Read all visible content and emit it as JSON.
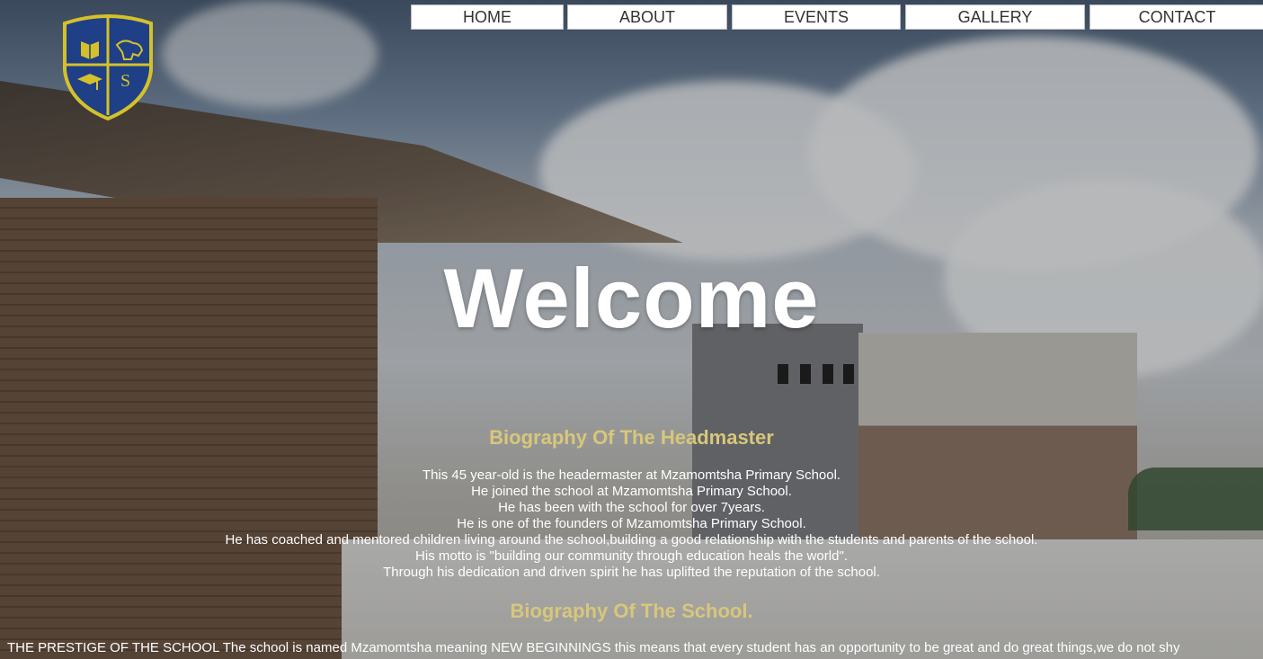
{
  "nav": {
    "items": [
      "HOME",
      "ABOUT",
      "EVENTS",
      "GALLERY",
      "CONTACT"
    ]
  },
  "crest": {
    "icon": "school-crest-shield",
    "letter": "S"
  },
  "hero": {
    "title": "Welcome"
  },
  "headmaster": {
    "heading": "Biography Of The Headmaster",
    "lines": [
      "This 45 year-old is the headermaster at Mzamomtsha Primary School.",
      "He joined the school at Mzamomtsha Primary School.",
      "He has been with the school for over 7years.",
      "He is one of the founders of Mzamomtsha Primary School.",
      "He has coached and mentored children living around the school,building a good relationship with the students and parents of the school.",
      "His motto is \"building our community through education heals the world\".",
      "Through his dedication and driven spirit he has uplifted the reputation of the school."
    ]
  },
  "school": {
    "heading": "Biography Of The School.",
    "text": "THE PRESTIGE OF THE SCHOOL The school is named Mzamomtsha meaning NEW BEGINNINGS this means that every student has an opportunity to be great and do great things,we do not shy"
  },
  "colors": {
    "accent_gold": "#d8c77a",
    "crest_blue": "#1f3f86",
    "crest_gold": "#d4c12a"
  }
}
